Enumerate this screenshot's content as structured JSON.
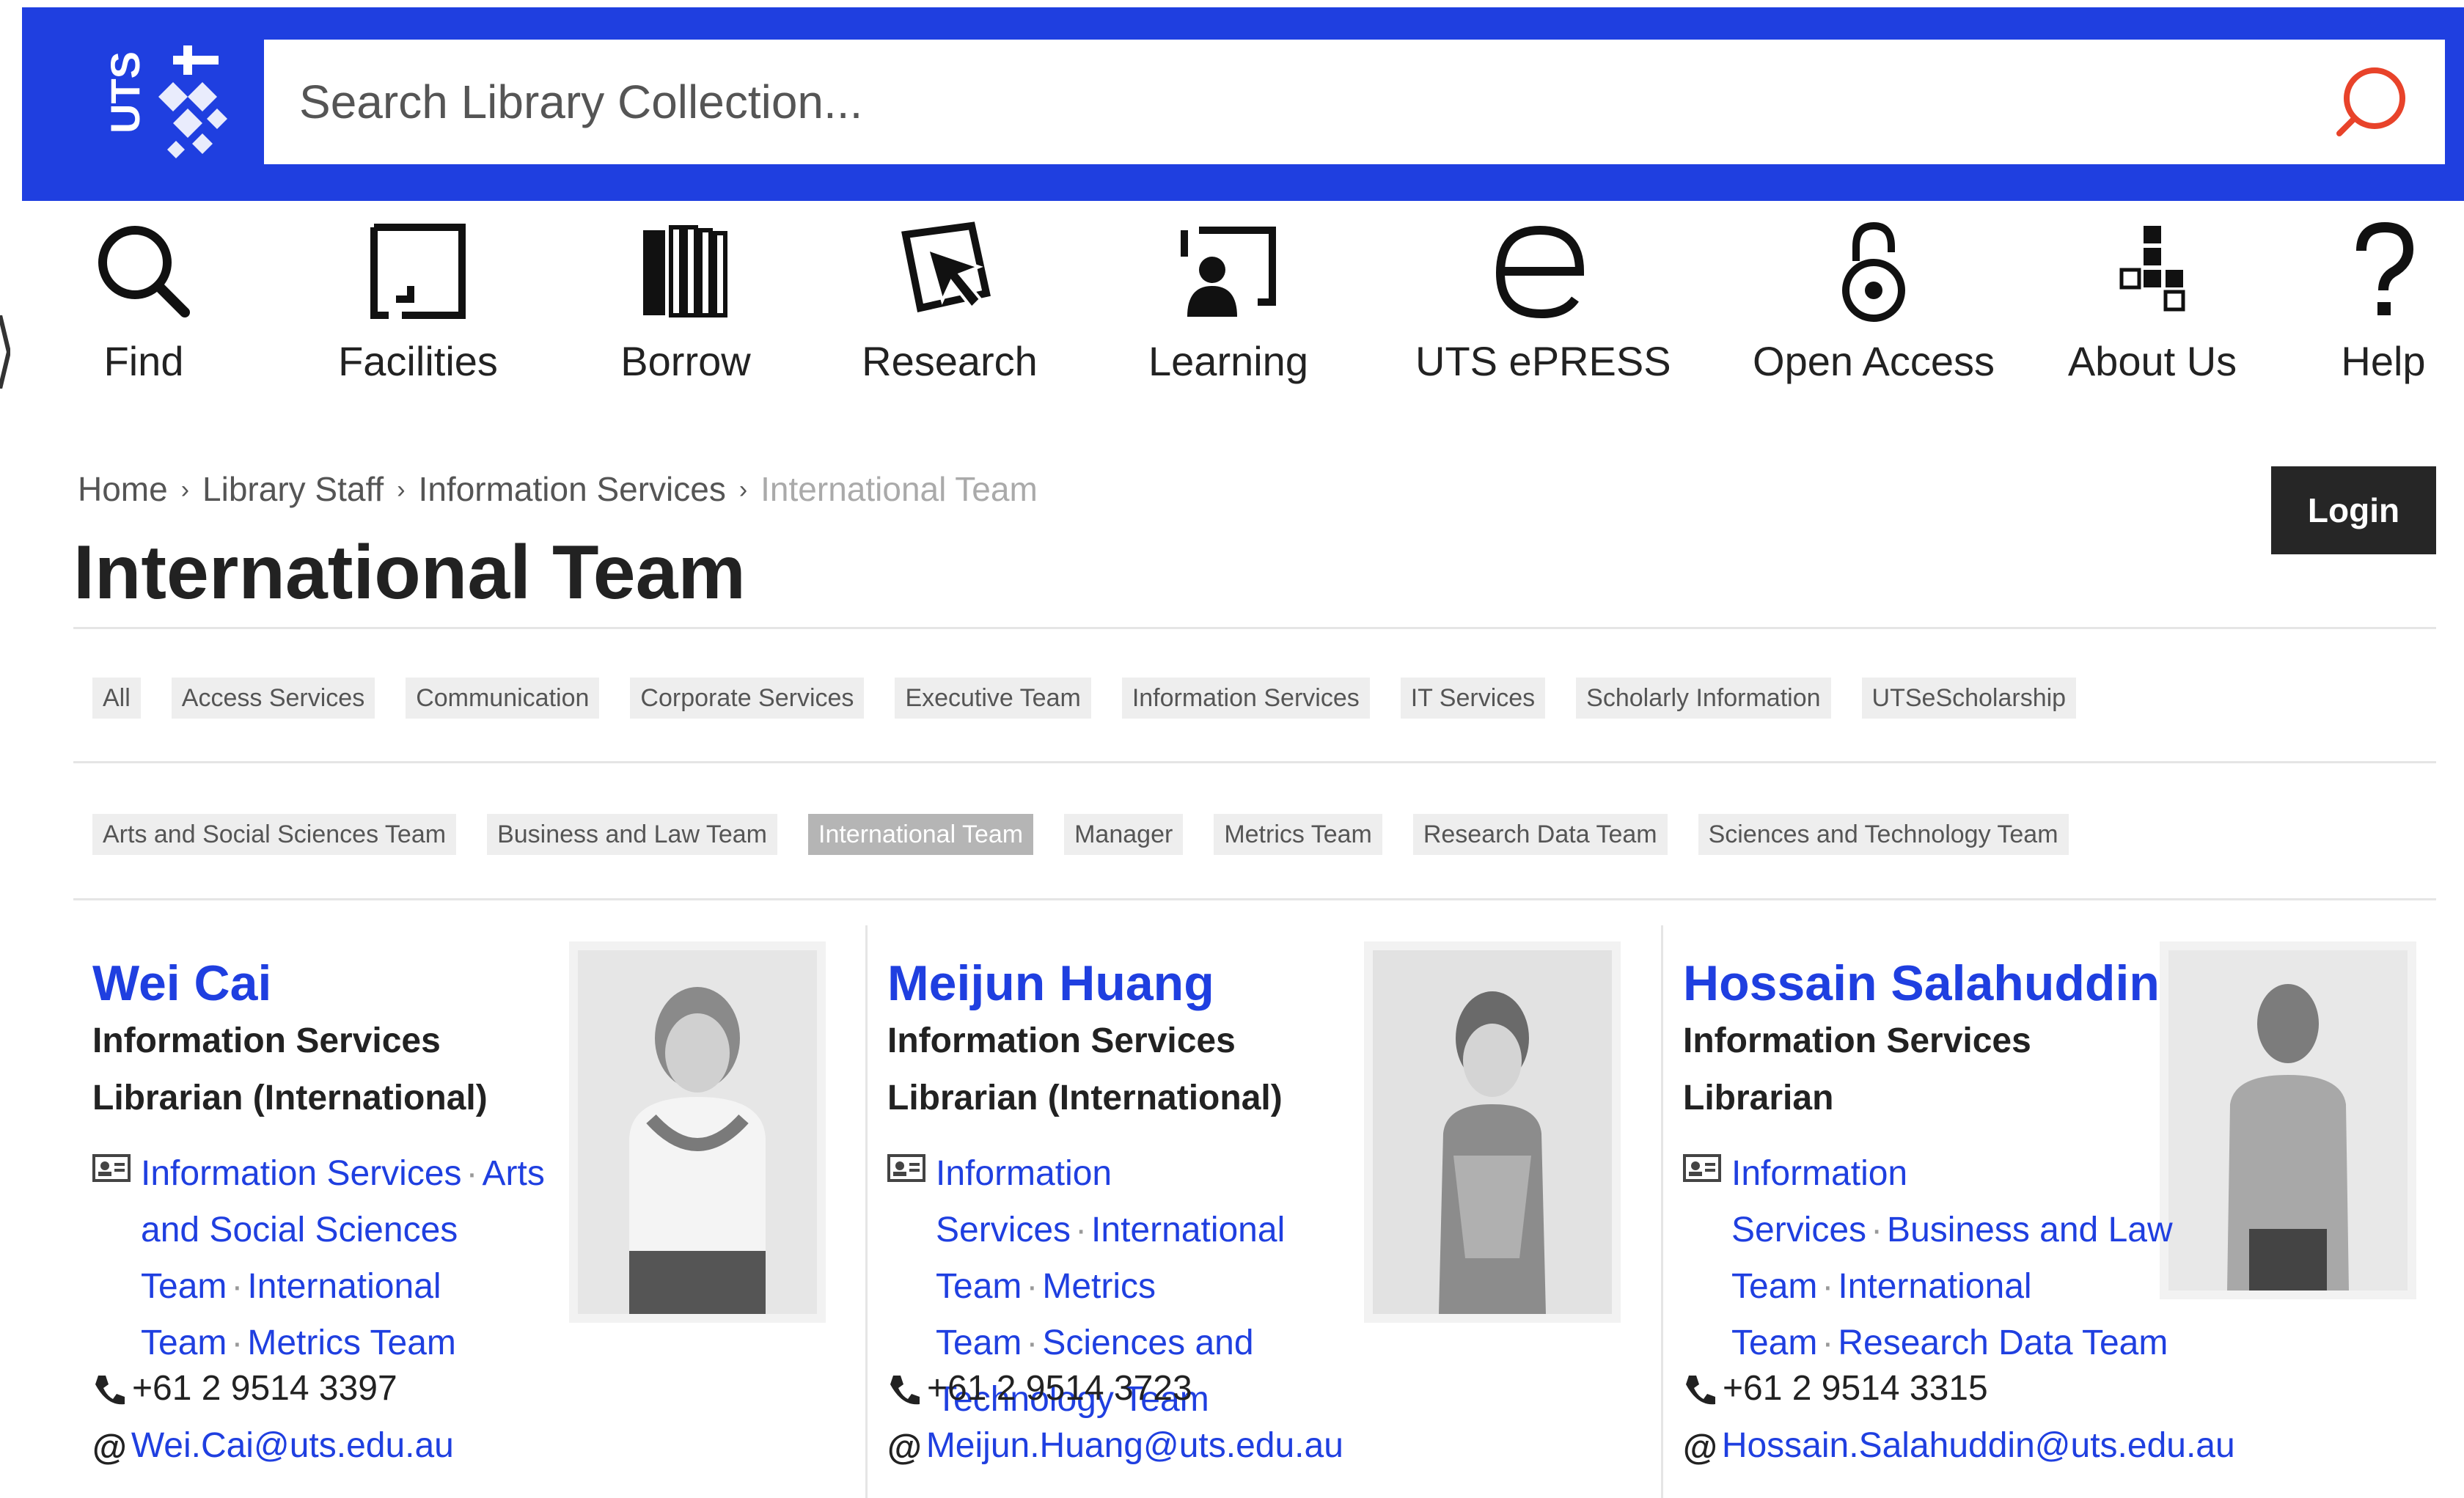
{
  "header": {
    "logo_text": "UTS",
    "search_placeholder": "Search Library Collection..."
  },
  "nav": {
    "items": [
      {
        "label": "Find",
        "icon": "magnifier-icon"
      },
      {
        "label": "Facilities",
        "icon": "facilities-icon"
      },
      {
        "label": "Borrow",
        "icon": "books-icon"
      },
      {
        "label": "Research",
        "icon": "research-icon"
      },
      {
        "label": "Learning",
        "icon": "learning-icon"
      },
      {
        "label": "UTS ePRESS",
        "icon": "epress-icon"
      },
      {
        "label": "Open Access",
        "icon": "open-lock-icon"
      },
      {
        "label": "About Us",
        "icon": "about-icon"
      },
      {
        "label": "Help",
        "icon": "question-icon"
      }
    ]
  },
  "breadcrumb": {
    "items": [
      "Home",
      "Library Staff",
      "Information Services"
    ],
    "current": "International Team"
  },
  "login_label": "Login",
  "page_title": "International Team",
  "filters": {
    "row1": [
      "All",
      "Access Services",
      "Communication",
      "Corporate Services",
      "Executive Team",
      "Information Services",
      "IT Services",
      "Scholarly Information",
      "UTSeScholarship"
    ],
    "row2": [
      "Arts and Social Sciences Team",
      "Business and Law Team",
      "International Team",
      "Manager",
      "Metrics Team",
      "Research Data Team",
      "Sciences and Technology Team"
    ],
    "active": "International Team"
  },
  "staff": [
    {
      "name": "Wei Cai",
      "department": "Information Services",
      "role": "Librarian (International)",
      "teams": [
        "Information Services",
        "Arts and Social Sciences Team",
        "International Team",
        "Metrics Team"
      ],
      "phone": "+61 2 9514 3397",
      "email": "Wei.Cai@uts.edu.au"
    },
    {
      "name": "Meijun Huang",
      "department": "Information Services",
      "role": "Librarian (International)",
      "teams": [
        "Information Services",
        "International Team",
        "Metrics Team",
        "Sciences and Technology Team"
      ],
      "phone": "+61 2 9514 3723",
      "email": "Meijun.Huang@uts.edu.au"
    },
    {
      "name": "Hossain Salahuddin",
      "department": "Information Services",
      "role": "Librarian",
      "teams": [
        "Information Services",
        "Business and Law Team",
        "International Team",
        "Research Data Team"
      ],
      "phone": "+61 2 9514 3315",
      "email": "Hossain.Salahuddin@uts.edu.au"
    }
  ],
  "colors": {
    "brand_blue": "#1f3fe0",
    "search_icon": "#e8432a",
    "login_bg": "#262626"
  }
}
